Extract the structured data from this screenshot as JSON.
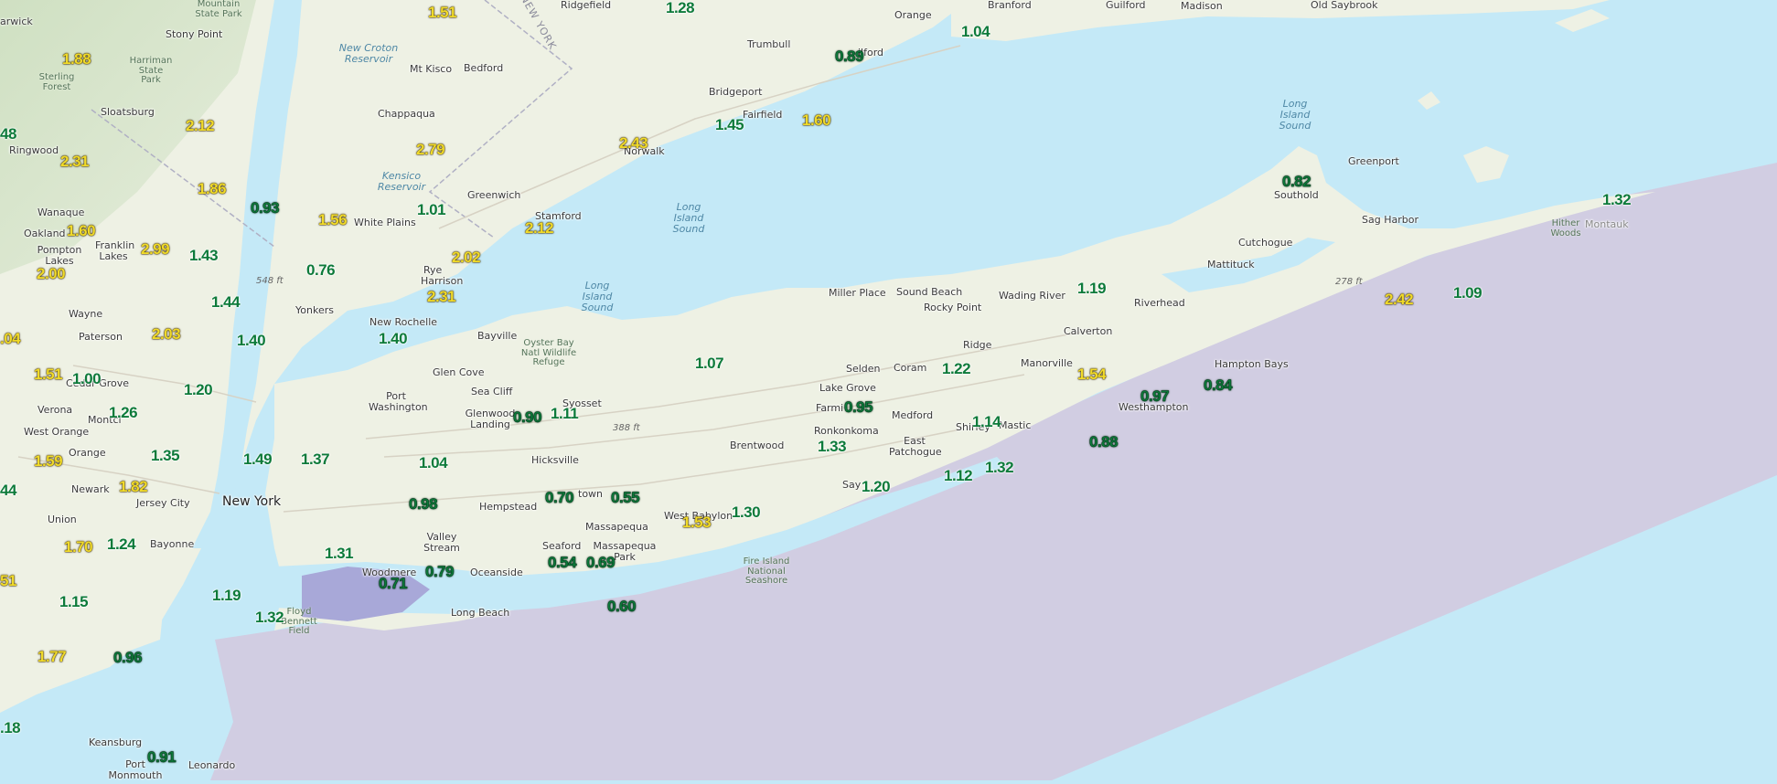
{
  "colors": {
    "water": "#c4e9f7",
    "ocean_zone": "#d1cde2",
    "land": "#eef1e4",
    "value_green": "#0d7a3a",
    "value_yellow": "#f0da2a"
  },
  "places": [
    {
      "id": "warwick",
      "name": "arwick"
    },
    {
      "id": "stony-point",
      "name": "Stony Point"
    },
    {
      "id": "sterling-forest",
      "name": "Sterling Forest"
    },
    {
      "id": "harriman",
      "name": "Harriman State Park"
    },
    {
      "id": "sloatsburg",
      "name": "Sloatsburg"
    },
    {
      "id": "ringwood",
      "name": "Ringwood"
    },
    {
      "id": "wanaque",
      "name": "Wanaque"
    },
    {
      "id": "oakland",
      "name": "Oakland"
    },
    {
      "id": "pompton-lakes",
      "name": "Pompton Lakes"
    },
    {
      "id": "franklin-lakes",
      "name": "Franklin Lakes"
    },
    {
      "id": "wayne",
      "name": "Wayne"
    },
    {
      "id": "paterson",
      "name": "Paterson"
    },
    {
      "id": "cedar-grove",
      "name": "Cedar Grove"
    },
    {
      "id": "verona",
      "name": "Verona"
    },
    {
      "id": "montclair",
      "name": "Montcl"
    },
    {
      "id": "west-orange",
      "name": "West Orange"
    },
    {
      "id": "orange",
      "name": "Orange"
    },
    {
      "id": "newark",
      "name": "Newark"
    },
    {
      "id": "jersey-city",
      "name": "Jersey City"
    },
    {
      "id": "union",
      "name": "Union"
    },
    {
      "id": "bayonne",
      "name": "Bayonne"
    },
    {
      "id": "keansburg",
      "name": "Keansburg"
    },
    {
      "id": "port-monmouth",
      "name": "Port Monmouth"
    },
    {
      "id": "leonardo",
      "name": "Leonardo"
    },
    {
      "id": "new-york",
      "name": "New York"
    },
    {
      "id": "yonkers",
      "name": "Yonkers"
    },
    {
      "id": "new-rochelle",
      "name": "New Rochelle"
    },
    {
      "id": "white-plains",
      "name": "White Plains"
    },
    {
      "id": "rye",
      "name": "Rye"
    },
    {
      "id": "harrison",
      "name": "Harrison"
    },
    {
      "id": "mt-kisco",
      "name": "Mt Kisco"
    },
    {
      "id": "bedford",
      "name": "Bedford"
    },
    {
      "id": "chappaqua",
      "name": "Chappaqua"
    },
    {
      "id": "greenwich",
      "name": "Greenwich"
    },
    {
      "id": "stamford",
      "name": "Stamford"
    },
    {
      "id": "norwalk",
      "name": "Norwalk"
    },
    {
      "id": "fairfield",
      "name": "Fairfield"
    },
    {
      "id": "bridgeport",
      "name": "Bridgeport"
    },
    {
      "id": "trumbull",
      "name": "Trumbull"
    },
    {
      "id": "ridgefield",
      "name": "Ridgefield"
    },
    {
      "id": "orange-ct",
      "name": "Orange"
    },
    {
      "id": "milford",
      "name": "ilford"
    },
    {
      "id": "branford",
      "name": "Branford"
    },
    {
      "id": "guilford",
      "name": "Guilford"
    },
    {
      "id": "madison",
      "name": "Madison"
    },
    {
      "id": "old-saybrook",
      "name": "Old Saybrook"
    },
    {
      "id": "bayville",
      "name": "Bayville"
    },
    {
      "id": "glen-cove",
      "name": "Glen Cove"
    },
    {
      "id": "sea-cliff",
      "name": "Sea Cliff"
    },
    {
      "id": "port-washington",
      "name": "Port Washington"
    },
    {
      "id": "glenwood-landing",
      "name": "Glenwood Landing"
    },
    {
      "id": "syosset",
      "name": "Syosset"
    },
    {
      "id": "hicksville",
      "name": "Hicksville"
    },
    {
      "id": "hempstead",
      "name": "Hempstead"
    },
    {
      "id": "valley-stream",
      "name": "Valley Stream"
    },
    {
      "id": "woodmere",
      "name": "Woodmere"
    },
    {
      "id": "oceanside",
      "name": "Oceanside"
    },
    {
      "id": "long-beach",
      "name": "Long Beach"
    },
    {
      "id": "seaford",
      "name": "Seaford"
    },
    {
      "id": "massapequa",
      "name": "Massapequa"
    },
    {
      "id": "massapequa-park",
      "name": "Massapequa Park"
    },
    {
      "id": "levittown",
      "name": "town"
    },
    {
      "id": "west-babylon",
      "name": "West Babylon"
    },
    {
      "id": "brentwood",
      "name": "Brentwood"
    },
    {
      "id": "ronkonkoma",
      "name": "Ronkonkoma"
    },
    {
      "id": "lake-grove",
      "name": "Lake Grove"
    },
    {
      "id": "farmingville",
      "name": "Farmi"
    },
    {
      "id": "selden",
      "name": "Selden"
    },
    {
      "id": "coram",
      "name": "Coram"
    },
    {
      "id": "medford",
      "name": "Medford"
    },
    {
      "id": "east-patchogue",
      "name": "East Patchogue"
    },
    {
      "id": "sayville",
      "name": "Say"
    },
    {
      "id": "shirley",
      "name": "Shirley"
    },
    {
      "id": "mastic",
      "name": "Mastic"
    },
    {
      "id": "miller-place",
      "name": "Miller Place"
    },
    {
      "id": "sound-beach",
      "name": "Sound Beach"
    },
    {
      "id": "rocky-point",
      "name": "Rocky Point"
    },
    {
      "id": "ridge",
      "name": "Ridge"
    },
    {
      "id": "wading-river",
      "name": "Wading River"
    },
    {
      "id": "calverton",
      "name": "Calverton"
    },
    {
      "id": "manorville",
      "name": "Manorville"
    },
    {
      "id": "riverhead",
      "name": "Riverhead"
    },
    {
      "id": "westhampton",
      "name": "Westhampton"
    },
    {
      "id": "hampton-bays",
      "name": "Hampton Bays"
    },
    {
      "id": "mattituck",
      "name": "Mattituck"
    },
    {
      "id": "cutchogue",
      "name": "Cutchogue"
    },
    {
      "id": "southold",
      "name": "Southold"
    },
    {
      "id": "greenport",
      "name": "Greenport"
    },
    {
      "id": "sag-harbor",
      "name": "Sag Harbor"
    },
    {
      "id": "montauk",
      "name": "Montauk"
    }
  ],
  "water_labels": [
    {
      "id": "lis-1",
      "text": "Long Island Sound"
    },
    {
      "id": "lis-2",
      "text": "Long Island Sound"
    },
    {
      "id": "lis-3",
      "text": "Long Island Sound"
    },
    {
      "id": "new-croton",
      "text": "New Croton Reservoir"
    },
    {
      "id": "kensico",
      "text": "Kensico Reservoir"
    }
  ],
  "park_labels": [
    {
      "id": "bear-mountain",
      "text": "Mountain State Park"
    },
    {
      "id": "oyster-bay",
      "text": "Oyster Bay Natl Wildlife Refuge"
    },
    {
      "id": "fire-island",
      "text": "Fire Island National Seashore"
    },
    {
      "id": "hither-woods",
      "text": "Hither Woods"
    },
    {
      "id": "floyd-bennett",
      "text": "Floyd Bennett Field"
    }
  ],
  "state_label": "NEW YORK",
  "elevations": [
    {
      "id": "elev-548",
      "text": "548 ft"
    },
    {
      "id": "elev-388",
      "text": "388 ft"
    },
    {
      "id": "elev-278",
      "text": "278 ft"
    }
  ],
  "values": [
    {
      "v": "1.88",
      "c": "yellow"
    },
    {
      "v": "2.12",
      "c": "yellow"
    },
    {
      "v": "2.31",
      "c": "yellow"
    },
    {
      "v": "1.86",
      "c": "yellow"
    },
    {
      "v": "0.93",
      "c": "dkgreen"
    },
    {
      "v": "1.60",
      "c": "yellow"
    },
    {
      "v": "2.99",
      "c": "yellow"
    },
    {
      "v": "1.43",
      "c": "green"
    },
    {
      "v": "2.00",
      "c": "yellow"
    },
    {
      "v": "0.76",
      "c": "green"
    },
    {
      "v": "1.44",
      "c": "green"
    },
    {
      "v": "2.03",
      "c": "yellow"
    },
    {
      "v": "1.40",
      "c": "green"
    },
    {
      "v": "1.51",
      "c": "yellow"
    },
    {
      "v": "1.00",
      "c": "green"
    },
    {
      "v": "1.20",
      "c": "green"
    },
    {
      "v": "1.26",
      "c": "green"
    },
    {
      "v": "1.59",
      "c": "yellow"
    },
    {
      "v": "1.35",
      "c": "green"
    },
    {
      "v": "1.49",
      "c": "green"
    },
    {
      "v": "1.37",
      "c": "green"
    },
    {
      "v": "1.82",
      "c": "yellow"
    },
    {
      "v": "1.70",
      "c": "yellow"
    },
    {
      "v": "1.24",
      "c": "green"
    },
    {
      "v": "1.31",
      "c": "green"
    },
    {
      "v": "1.15",
      "c": "green"
    },
    {
      "v": "1.19",
      "c": "green"
    },
    {
      "v": "1.32",
      "c": "green"
    },
    {
      "v": "1.77",
      "c": "yellow"
    },
    {
      "v": "0.96",
      "c": "dkgreen"
    },
    {
      "v": "0.91",
      "c": "dkgreen"
    },
    {
      "v": "1.51",
      "c": "yellow"
    },
    {
      "v": "1.56",
      "c": "yellow"
    },
    {
      "v": "1.01",
      "c": "green"
    },
    {
      "v": "2.79",
      "c": "yellow"
    },
    {
      "v": "2.02",
      "c": "yellow"
    },
    {
      "v": "2.31",
      "c": "yellow"
    },
    {
      "v": "1.40",
      "c": "green"
    },
    {
      "v": "2.12",
      "c": "yellow"
    },
    {
      "v": "2.43",
      "c": "yellow"
    },
    {
      "v": "1.45",
      "c": "green"
    },
    {
      "v": "1.60",
      "c": "yellow"
    },
    {
      "v": "0.89",
      "c": "dkgreen"
    },
    {
      "v": "1.28",
      "c": "green"
    },
    {
      "v": "1.04",
      "c": "green"
    },
    {
      "v": "1.04",
      "c": "green"
    },
    {
      "v": "0.98",
      "c": "dkgreen"
    },
    {
      "v": "0.90",
      "c": "dkgreen"
    },
    {
      "v": "1.11",
      "c": "green"
    },
    {
      "v": "0.70",
      "c": "dkgreen"
    },
    {
      "v": "0.55",
      "c": "dkgreen"
    },
    {
      "v": "0.79",
      "c": "dkgreen"
    },
    {
      "v": "0.71",
      "c": "dkgreen"
    },
    {
      "v": "0.54",
      "c": "dkgreen"
    },
    {
      "v": "0.69",
      "c": "dkgreen"
    },
    {
      "v": "0.60",
      "c": "dkgreen"
    },
    {
      "v": "1.53",
      "c": "yellow"
    },
    {
      "v": "1.30",
      "c": "green"
    },
    {
      "v": "1.07",
      "c": "green"
    },
    {
      "v": "0.95",
      "c": "dkgreen"
    },
    {
      "v": "1.33",
      "c": "green"
    },
    {
      "v": "1.20",
      "c": "green"
    },
    {
      "v": "1.22",
      "c": "green"
    },
    {
      "v": "1.12",
      "c": "green"
    },
    {
      "v": "1.32",
      "c": "green"
    },
    {
      "v": "1.14",
      "c": "green"
    },
    {
      "v": "1.19",
      "c": "green"
    },
    {
      "v": "1.54",
      "c": "yellow"
    },
    {
      "v": "0.97",
      "c": "dkgreen"
    },
    {
      "v": "0.84",
      "c": "dkgreen"
    },
    {
      "v": "0.88",
      "c": "dkgreen"
    },
    {
      "v": "2.42",
      "c": "yellow"
    },
    {
      "v": "1.09",
      "c": "green"
    },
    {
      "v": "0.82",
      "c": "dkgreen"
    },
    {
      "v": "1.32",
      "c": "green"
    },
    {
      "v": "48",
      "c": "green"
    },
    {
      "v": ".04",
      "c": "yellow"
    },
    {
      "v": "44",
      "c": "green"
    },
    {
      "v": "51",
      "c": "yellow"
    },
    {
      "v": ".18",
      "c": "green"
    }
  ]
}
